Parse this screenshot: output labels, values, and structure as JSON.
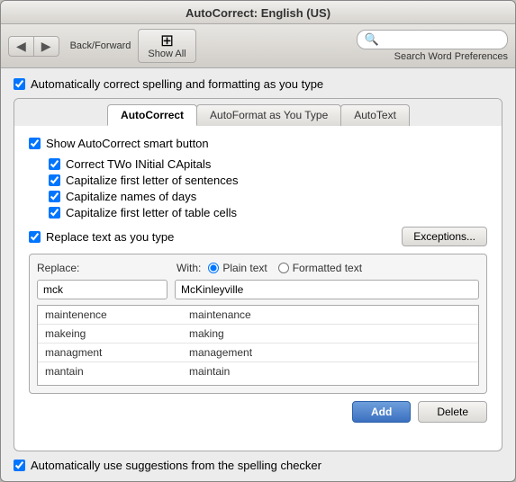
{
  "window": {
    "title": "AutoCorrect: English (US)"
  },
  "toolbar": {
    "nav_back": "◀",
    "nav_forward": "▶",
    "nav_label": "Back/Forward",
    "show_all_icon": "⊞",
    "show_all_label": "Show All",
    "search_placeholder": "",
    "search_label": "Search Word Preferences"
  },
  "top_checkbox": {
    "label": "Automatically correct spelling and formatting as you type",
    "checked": true
  },
  "tabs": [
    {
      "id": "autocorrect",
      "label": "AutoCorrect",
      "active": true
    },
    {
      "id": "autoformat",
      "label": "AutoFormat as You Type",
      "active": false
    },
    {
      "id": "autotext",
      "label": "AutoText",
      "active": false
    }
  ],
  "autocorrect_tab": {
    "show_smart_button": {
      "label": "Show AutoCorrect smart button",
      "checked": true
    },
    "sub_options": [
      {
        "label": "Correct TWo INitial CApitals",
        "checked": true
      },
      {
        "label": "Capitalize first letter of sentences",
        "checked": true
      },
      {
        "label": "Capitalize names of days",
        "checked": true
      },
      {
        "label": "Capitalize first letter of table cells",
        "checked": true
      }
    ],
    "replace_checkbox": {
      "label": "Replace text as you type",
      "checked": true
    },
    "exceptions_btn": "Exceptions...",
    "with_label": "With:",
    "plain_text_label": "Plain text",
    "formatted_text_label": "Formatted text",
    "replace_label": "Replace:",
    "replace_value": "mck",
    "with_value": "McKinleyville",
    "table_rows": [
      {
        "replace": "maintenence",
        "with": "maintenance"
      },
      {
        "replace": "makeing",
        "with": "making"
      },
      {
        "replace": "managment",
        "with": "management"
      },
      {
        "replace": "mantain",
        "with": "maintain"
      }
    ],
    "add_btn": "Add",
    "delete_btn": "Delete"
  },
  "bottom_checkbox": {
    "label": "Automatically use suggestions from the spelling checker",
    "checked": true
  }
}
